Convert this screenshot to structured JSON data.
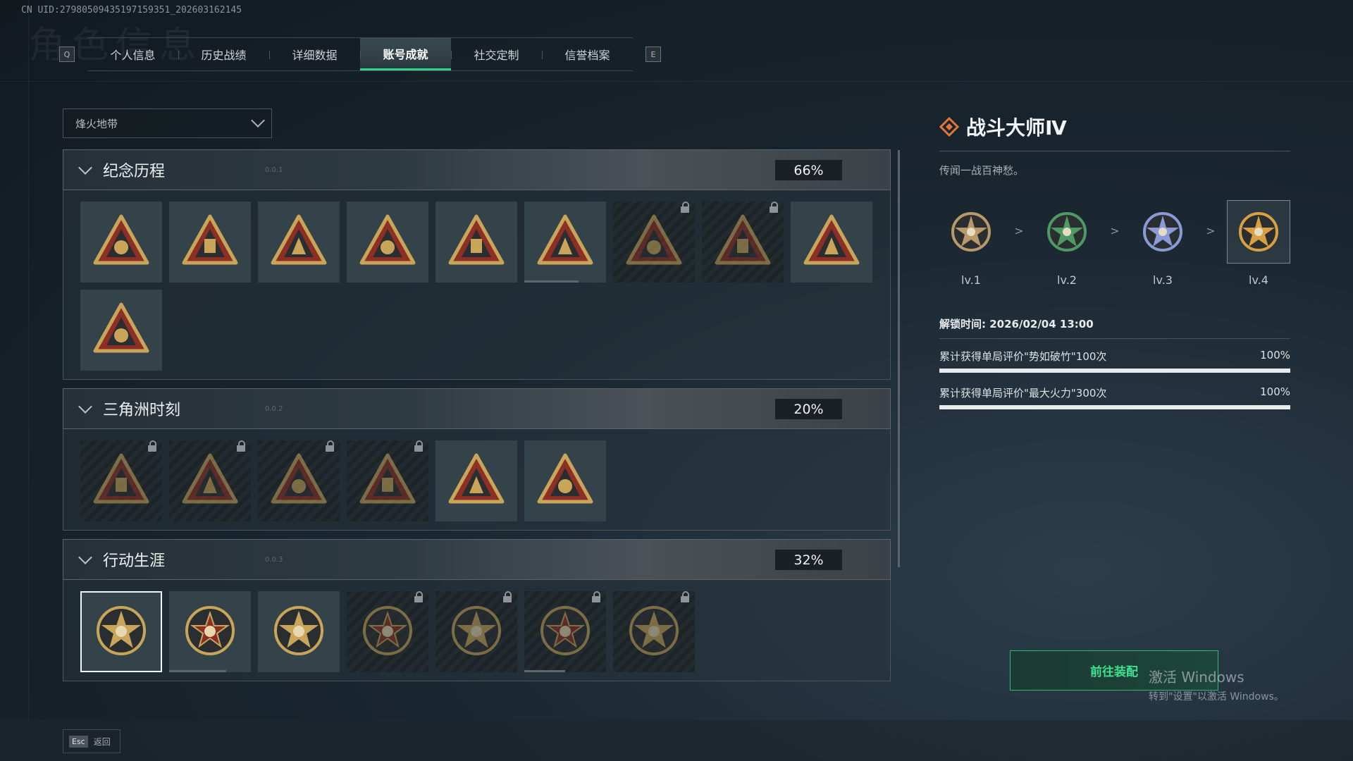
{
  "uid": "CN UID:27980509435197159351_202603162145",
  "bg_title": "角色信息",
  "tabs": {
    "left_key": "Q",
    "right_key": "E",
    "items": [
      "个人信息",
      "历史战绩",
      "详细数据",
      "账号成就",
      "社交定制",
      "信誉档案"
    ],
    "active_index": 3
  },
  "mode_select": {
    "value": "烽火地带"
  },
  "sections": [
    {
      "title": "纪念历程",
      "code": "0.0.1",
      "percent": "66%",
      "badges": [
        {
          "icon": "triangle-shield-emblem",
          "locked": false
        },
        {
          "icon": "helicopter-shield-emblem",
          "locked": false
        },
        {
          "icon": "hexagon-shield-emblem",
          "locked": false
        },
        {
          "icon": "s6-triangle-emblem",
          "locked": false
        },
        {
          "icon": "s7-triangle-emblem",
          "locked": false
        },
        {
          "icon": "s8-triangle-emblem",
          "locked": false,
          "progress": 0.66
        },
        {
          "icon": "hooded-figure-emblem",
          "locked": true
        },
        {
          "icon": "skull-triangle-emblem",
          "locked": true
        },
        {
          "icon": "hand-triangle-emblem",
          "locked": false
        },
        {
          "icon": "number-one-triangle-emblem",
          "locked": false
        }
      ]
    },
    {
      "title": "三角洲时刻",
      "code": "0.0.2",
      "percent": "20%",
      "badges": [
        {
          "icon": "bag-triangle-emblem",
          "locked": true
        },
        {
          "icon": "device-triangle-emblem",
          "locked": true
        },
        {
          "icon": "runner-triangle-emblem",
          "locked": true
        },
        {
          "icon": "spiral-triangle-emblem",
          "locked": true
        },
        {
          "icon": "squad-triangle-emblem",
          "locked": false
        },
        {
          "icon": "rocket-triangle-emblem",
          "locked": false
        }
      ]
    },
    {
      "title": "行动生涯",
      "code": "0.0.3",
      "percent": "32%",
      "badges": [
        {
          "icon": "star-skull-medal",
          "locked": false,
          "selected": true
        },
        {
          "icon": "chevron-shield-medal",
          "locked": false,
          "progress": 0.7
        },
        {
          "icon": "winged-star-medal",
          "locked": false
        },
        {
          "icon": "gem-shield-medal",
          "locked": true
        },
        {
          "icon": "orb-medal",
          "locked": true
        },
        {
          "icon": "crosshair-skull-medal",
          "locked": true,
          "progress": 0.5
        },
        {
          "icon": "eye-medal",
          "locked": true
        }
      ]
    }
  ],
  "detail": {
    "title": "战斗大师Ⅳ",
    "description": "传闻一战百神愁。",
    "levels": [
      {
        "label": "lv.1",
        "color": "#b89a6a"
      },
      {
        "label": "lv.2",
        "color": "#4e9a63"
      },
      {
        "label": "lv.3",
        "color": "#8a9ad8"
      },
      {
        "label": "lv.4",
        "color": "#d8a040"
      }
    ],
    "current_level": 3,
    "unlock_time": "解锁时间: 2026/02/04 13:00",
    "requirements": [
      {
        "text": "累计获得单局评价\"势如破竹\"100次",
        "percent": "100%",
        "value": 1.0
      },
      {
        "text": "累计获得单局评价\"最大火力\"300次",
        "percent": "100%",
        "value": 1.0
      }
    ],
    "equip_button": "前往装配"
  },
  "watermark": {
    "line1": "激活 Windows",
    "line2": "转到\"设置\"以激活 Windows。"
  },
  "footer": {
    "esc_key": "Esc",
    "back_label": "返回"
  }
}
